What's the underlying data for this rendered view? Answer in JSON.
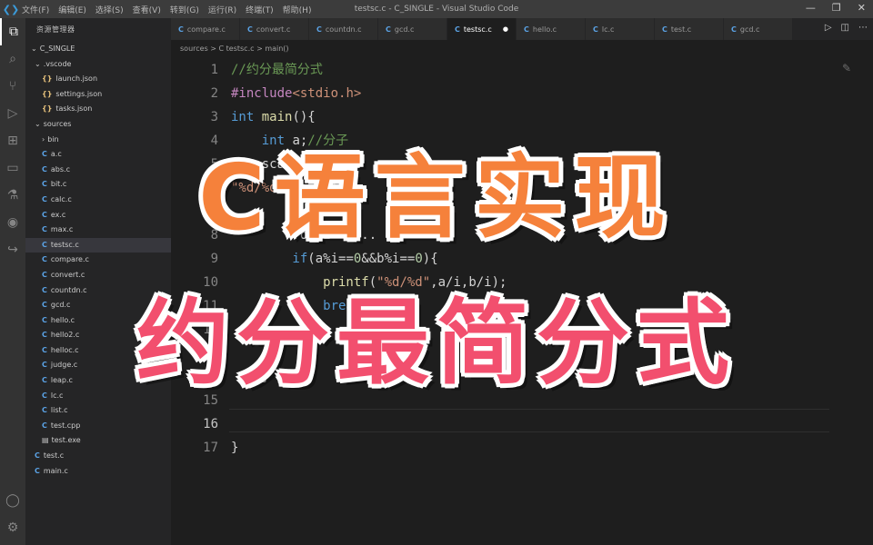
{
  "window": {
    "title": "testsc.c - C_SINGLE - Visual Studio Code",
    "menu": [
      "文件(F)",
      "编辑(E)",
      "选择(S)",
      "查看(V)",
      "转到(G)",
      "运行(R)",
      "终端(T)",
      "帮助(H)"
    ],
    "controls": [
      "—",
      "❐",
      "✕"
    ]
  },
  "explorer": {
    "header": "资源管理器",
    "items": [
      {
        "label": "C_SINGLE",
        "kind": "folder-open"
      },
      {
        "label": ".vscode",
        "kind": "folder-open"
      },
      {
        "label": "launch.json",
        "kind": "json"
      },
      {
        "label": "settings.json",
        "kind": "json"
      },
      {
        "label": "tasks.json",
        "kind": "json"
      },
      {
        "label": "sources",
        "kind": "folder-open"
      },
      {
        "label": "bin",
        "kind": "folder"
      },
      {
        "label": "a.c",
        "kind": "c"
      },
      {
        "label": "abs.c",
        "kind": "c"
      },
      {
        "label": "bit.c",
        "kind": "c"
      },
      {
        "label": "calc.c",
        "kind": "c"
      },
      {
        "label": "ex.c",
        "kind": "c"
      },
      {
        "label": "max.c",
        "kind": "c"
      },
      {
        "label": "testsc.c",
        "kind": "c",
        "selected": true
      },
      {
        "label": "compare.c",
        "kind": "c"
      },
      {
        "label": "convert.c",
        "kind": "c"
      },
      {
        "label": "countdn.c",
        "kind": "c"
      },
      {
        "label": "gcd.c",
        "kind": "c"
      },
      {
        "label": "hello.c",
        "kind": "c"
      },
      {
        "label": "hello2.c",
        "kind": "c"
      },
      {
        "label": "helloc.c",
        "kind": "c"
      },
      {
        "label": "judge.c",
        "kind": "c"
      },
      {
        "label": "leap.c",
        "kind": "c"
      },
      {
        "label": "lc.c",
        "kind": "c"
      },
      {
        "label": "list.c",
        "kind": "c"
      },
      {
        "label": "test.cpp",
        "kind": "c"
      },
      {
        "label": "test.exe",
        "kind": "exe"
      },
      {
        "label": "test.c",
        "kind": "c"
      },
      {
        "label": "main.c",
        "kind": "c"
      }
    ]
  },
  "tabs": [
    {
      "label": "compare.c",
      "active": false
    },
    {
      "label": "convert.c",
      "active": false
    },
    {
      "label": "countdn.c",
      "active": false
    },
    {
      "label": "gcd.c",
      "active": false
    },
    {
      "label": "testsc.c",
      "active": true,
      "dirty": true
    },
    {
      "label": "hello.c",
      "active": false
    },
    {
      "label": "lc.c",
      "active": false
    },
    {
      "label": "test.c",
      "active": false
    },
    {
      "label": "gcd.c",
      "active": false
    }
  ],
  "breadcrumb": "sources > C testsc.c > main()",
  "code": [
    {
      "n": "1",
      "t": [
        [
          "cmt",
          "//约分最简分式"
        ]
      ]
    },
    {
      "n": "2",
      "t": [
        [
          "pre",
          "#include"
        ],
        [
          "str",
          "<stdio.h>"
        ]
      ]
    },
    {
      "n": "3",
      "t": [
        [
          "kw",
          "int "
        ],
        [
          "fn",
          "main"
        ],
        [
          "id",
          "(){"
        ]
      ]
    },
    {
      "n": "4",
      "t": [
        [
          "kw",
          "    int "
        ],
        [
          "id",
          "a;"
        ],
        [
          "cmt",
          "//分子"
        ]
      ]
    },
    {
      "n": "5",
      "t": [
        [
          "id",
          "    scanf(...)"
        ]
      ]
    },
    {
      "n": "6",
      "t": [
        [
          "str",
          "\"%d/%d\""
        ],
        [
          "id",
          ",&a,&b);"
        ]
      ]
    },
    {
      "n": "7",
      "t": [
        [
          "id",
          ""
        ]
      ]
    },
    {
      "n": "8",
      "t": [
        [
          "id",
          "        for(i = ... ){"
        ]
      ]
    },
    {
      "n": "9",
      "t": [
        [
          "kw",
          "        if"
        ],
        [
          "id",
          "(a%i=="
        ],
        [
          "num",
          "0"
        ],
        [
          "id",
          "&&b%i=="
        ],
        [
          "num",
          "0"
        ],
        [
          "id",
          "){"
        ]
      ]
    },
    {
      "n": "10",
      "t": [
        [
          "fn",
          "            printf"
        ],
        [
          "id",
          "("
        ],
        [
          "str",
          "\"%d/%d\""
        ],
        [
          "id",
          ",a/i,b/i);"
        ]
      ]
    },
    {
      "n": "11",
      "t": [
        [
          "kw",
          "            break"
        ],
        [
          "id",
          ";"
        ]
      ]
    },
    {
      "n": "12",
      "t": [
        [
          "id",
          ""
        ]
      ]
    },
    {
      "n": "13",
      "t": [
        [
          "id",
          ""
        ]
      ]
    },
    {
      "n": "14",
      "t": [
        [
          "id",
          "    }"
        ]
      ]
    },
    {
      "n": "15",
      "t": [
        [
          "id",
          ""
        ]
      ]
    },
    {
      "n": "16",
      "t": [
        [
          "id",
          ""
        ]
      ]
    },
    {
      "n": "17",
      "t": [
        [
          "id",
          "}"
        ]
      ]
    }
  ],
  "overlay": {
    "line1": "C语言实现",
    "line2": "约分最简分式",
    "color1": "#f5813b",
    "color2": "#f24f6e"
  }
}
